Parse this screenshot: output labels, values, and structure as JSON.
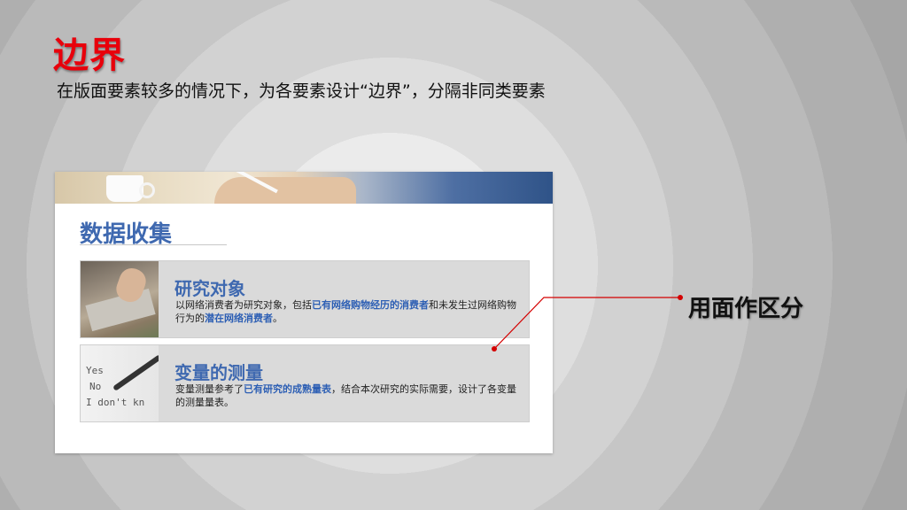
{
  "slide": {
    "title": "边界",
    "subtitle": "在版面要素较多的情况下，为各要素设计“边界”，分隔非同类要素"
  },
  "card": {
    "heading": "数据收集",
    "items": [
      {
        "title": "研究对象",
        "desc_parts": [
          "以网络消费者为研究对象，包括",
          "已有网络购物经历的消费者",
          "和未发生过网络购物行为的",
          "潜在网络消费者",
          "。"
        ]
      },
      {
        "title": "变量的测量",
        "desc_parts": [
          "变量测量参考了",
          "已有研究的成熟量表",
          "，结合本次研究的实际需要，设计了各变量的测量量表。"
        ]
      }
    ],
    "thumb2_text": {
      "yes": "Yes",
      "no": "No",
      "dont": "I don't kn"
    }
  },
  "annotation": {
    "label": "用面作区分",
    "color": "#d40000"
  },
  "colors": {
    "title_red": "#e8000b",
    "heading_blue": "#3f69b0",
    "highlight_blue": "#2d5fb4"
  }
}
